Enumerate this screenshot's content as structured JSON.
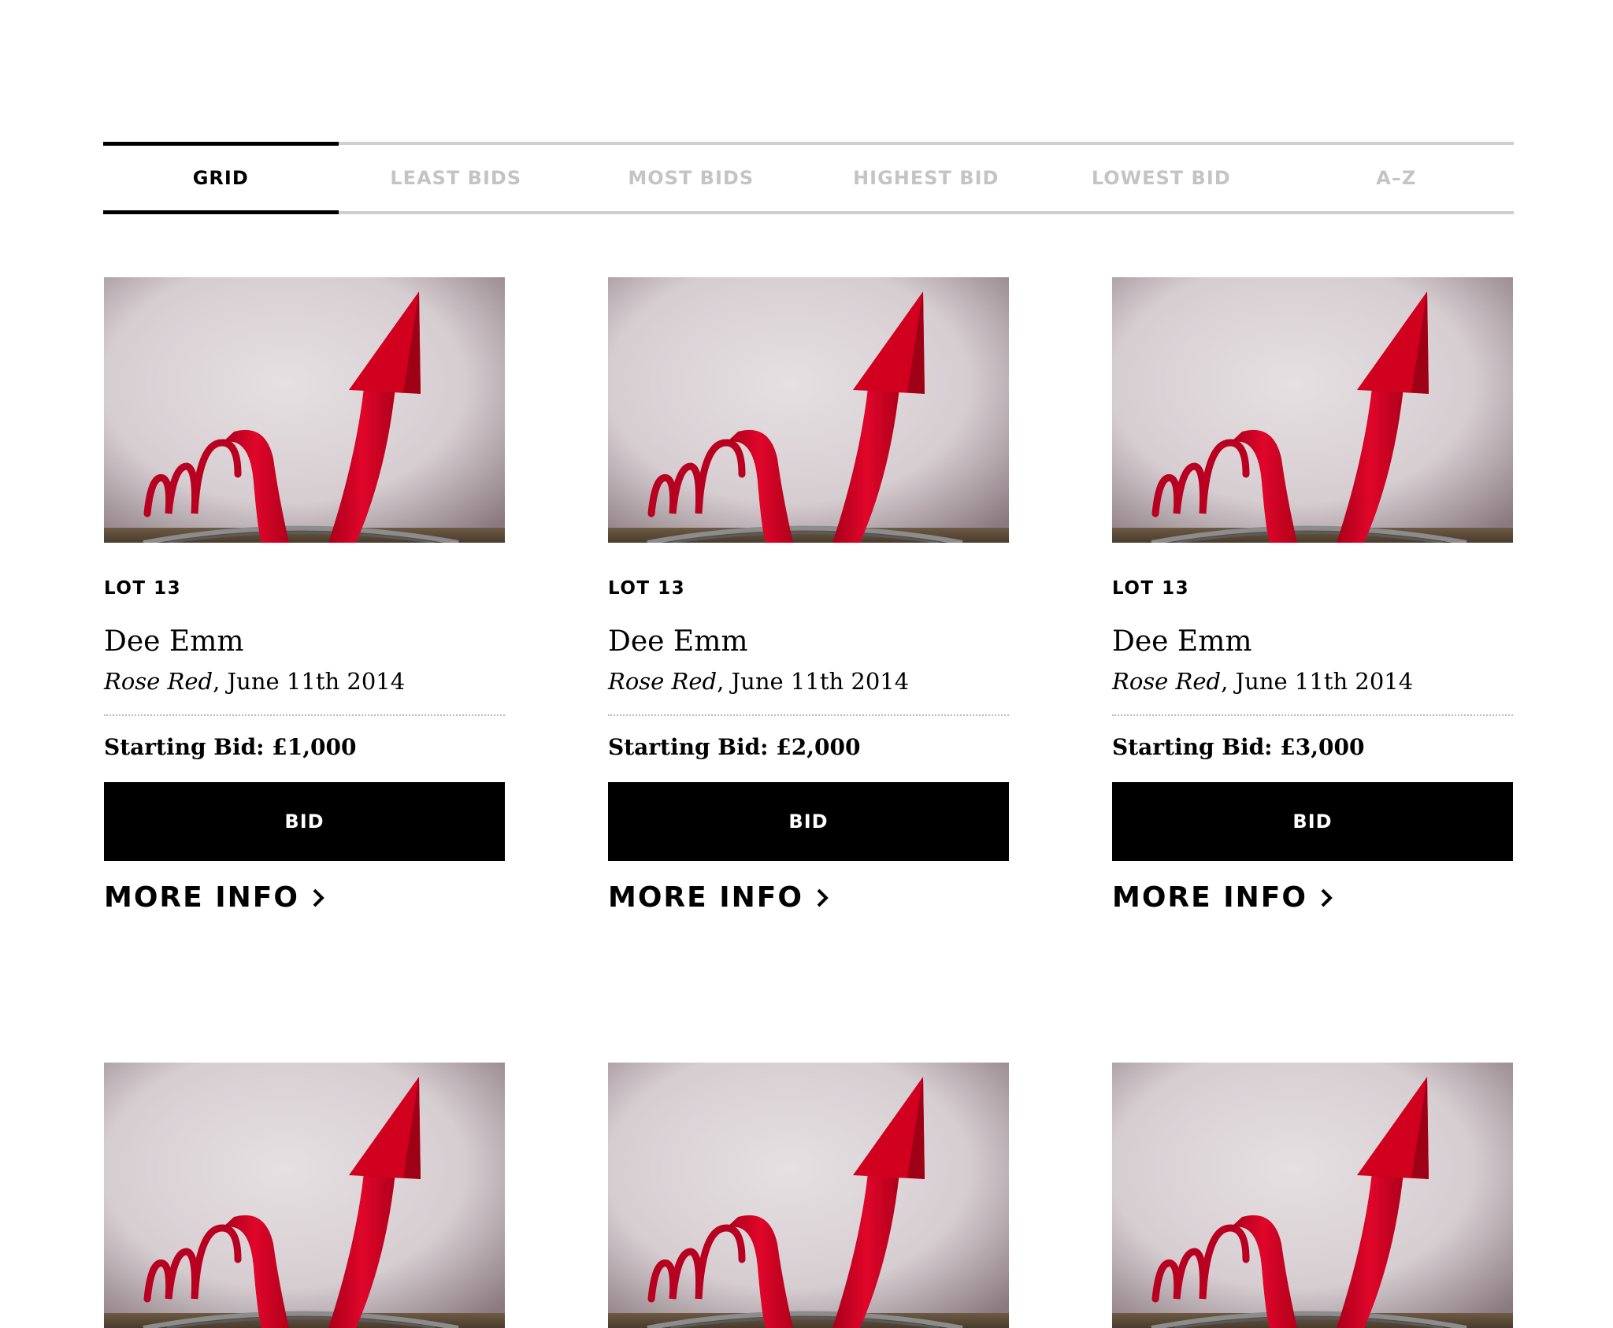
{
  "tabs": [
    {
      "label": "GRID",
      "active": true
    },
    {
      "label": "LEAST BIDS",
      "active": false
    },
    {
      "label": "MOST BIDS",
      "active": false
    },
    {
      "label": "HIGHEST BID",
      "active": false
    },
    {
      "label": "LOWEST BID",
      "active": false
    },
    {
      "label": "A–Z",
      "active": false
    }
  ],
  "lots": [
    {
      "lot": "LOT 13",
      "artist": "Dee Emm",
      "work": "Rose Red",
      "date": ", June 11th 2014",
      "starting_bid": "Starting Bid: £1,000",
      "bid_label": "BID",
      "more_info_label": "MORE INFO"
    },
    {
      "lot": "LOT 13",
      "artist": "Dee Emm",
      "work": "Rose Red",
      "date": ", June 11th 2014",
      "starting_bid": "Starting Bid: £2,000",
      "bid_label": "BID",
      "more_info_label": "MORE INFO"
    },
    {
      "lot": "LOT 13",
      "artist": "Dee Emm",
      "work": "Rose Red",
      "date": ", June 11th 2014",
      "starting_bid": "Starting Bid: £3,000",
      "bid_label": "BID",
      "more_info_label": "MORE INFO"
    }
  ],
  "colors": {
    "arrow": "#d3001c",
    "background_wall": "#dcd3d6",
    "button": "#000000",
    "inactive_tab": "#c4c4c4"
  },
  "icons": {
    "thumbnail": "red-arrow-sculpture-image",
    "more_info": "chevron-right-icon"
  }
}
